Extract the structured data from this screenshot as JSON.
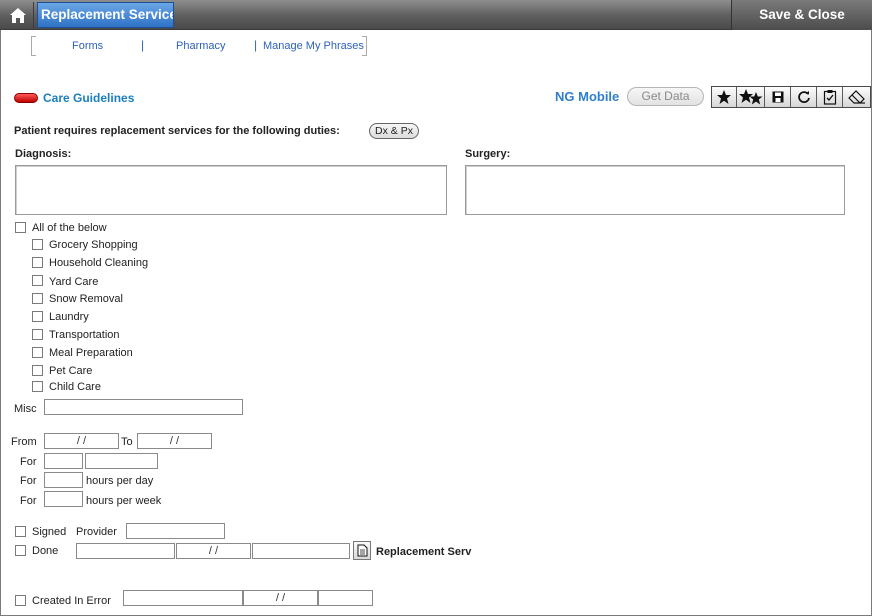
{
  "header": {
    "title": "Replacement Services",
    "save_close": "Save & Close"
  },
  "nav": {
    "items": [
      "Forms",
      "Pharmacy",
      "Manage My Phrases"
    ],
    "separator": "|"
  },
  "toolbar": {
    "care_guidelines": "Care Guidelines",
    "ng_mobile": "NG Mobile",
    "get_data": "Get Data"
  },
  "form": {
    "duties_label": "Patient requires replacement services for the following duties:",
    "dxpx": "Dx & Px",
    "diagnosis_label": "Diagnosis:",
    "surgery_label": "Surgery:",
    "all_label": "All of the below",
    "services": [
      "Grocery Shopping",
      "Household Cleaning",
      "Yard Care",
      "Snow Removal",
      "Laundry",
      "Transportation",
      "Meal Preparation",
      "Pet Care",
      "Child Care"
    ],
    "misc_label": "Misc",
    "from_label": "From",
    "to_label": "To",
    "date_placeholder": "/ /",
    "for_label": "For",
    "hours_per_day": "hours per day",
    "hours_per_week": "hours per week",
    "signed_label": "Signed",
    "provider_label": "Provider",
    "done_label": "Done",
    "replacement_serv": "Replacement Serv",
    "created_in_error": "Created In Error"
  }
}
